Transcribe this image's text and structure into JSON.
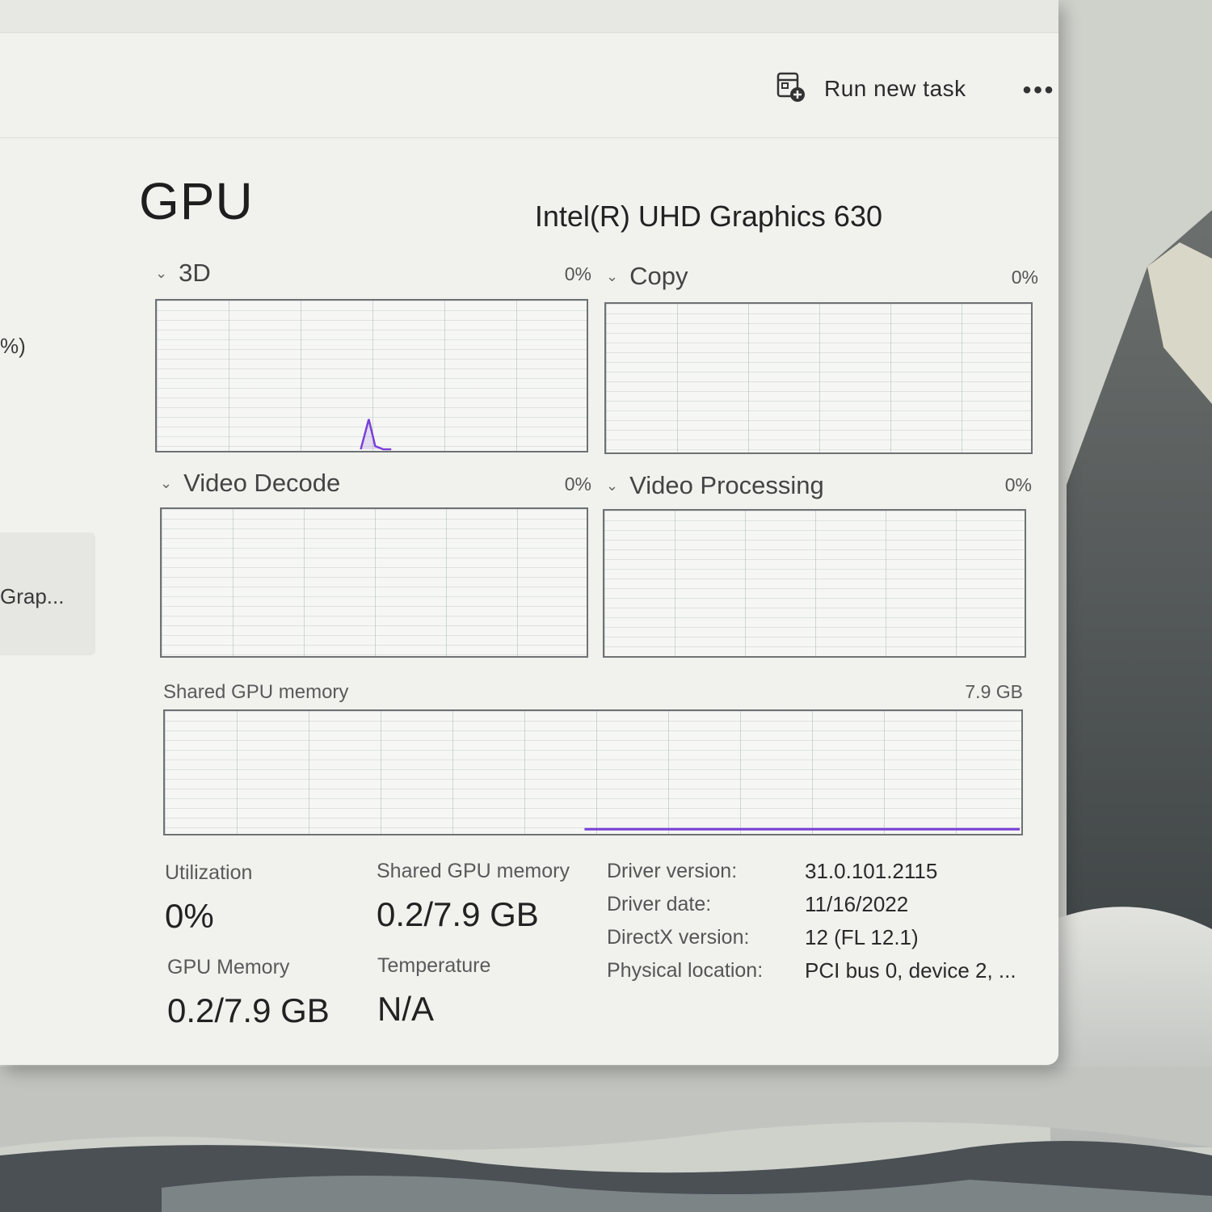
{
  "colors": {
    "accent_purple": "#7a3fd8",
    "window_bg": "#f1f2ee",
    "graph_border": "#6e7274"
  },
  "toolbar": {
    "run_new_task_icon": "run-task-icon",
    "run_new_task_label": "Run new task",
    "more_label": "•••"
  },
  "sidebar": {
    "fragment_1": "%)",
    "fragment_2": "Grap..."
  },
  "header": {
    "title": "GPU",
    "device": "Intel(R) UHD Graphics 630"
  },
  "engines": [
    {
      "name": "3D",
      "percent": "0%",
      "spike_peak_fraction": 0.2
    },
    {
      "name": "Copy",
      "percent": "0%"
    },
    {
      "name": "Video Decode",
      "percent": "0%"
    },
    {
      "name": "Video Processing",
      "percent": "0%"
    }
  ],
  "shared_memory_graph": {
    "label": "Shared GPU memory",
    "max": "7.9 GB",
    "usage_fraction": 0.025
  },
  "stats": {
    "utilization_label": "Utilization",
    "utilization_value": "0%",
    "shared_memory_label": "Shared GPU memory",
    "shared_memory_value": "0.2/7.9 GB",
    "gpu_memory_label": "GPU Memory",
    "gpu_memory_value": "0.2/7.9 GB",
    "temperature_label": "Temperature",
    "temperature_value": "N/A"
  },
  "info": [
    {
      "key": "Driver version:",
      "value": "31.0.101.2115"
    },
    {
      "key": "Driver date:",
      "value": "11/16/2022"
    },
    {
      "key": "DirectX version:",
      "value": "12 (FL 12.1)"
    },
    {
      "key": "Physical location:",
      "value": "PCI bus 0, device 2, ..."
    }
  ]
}
